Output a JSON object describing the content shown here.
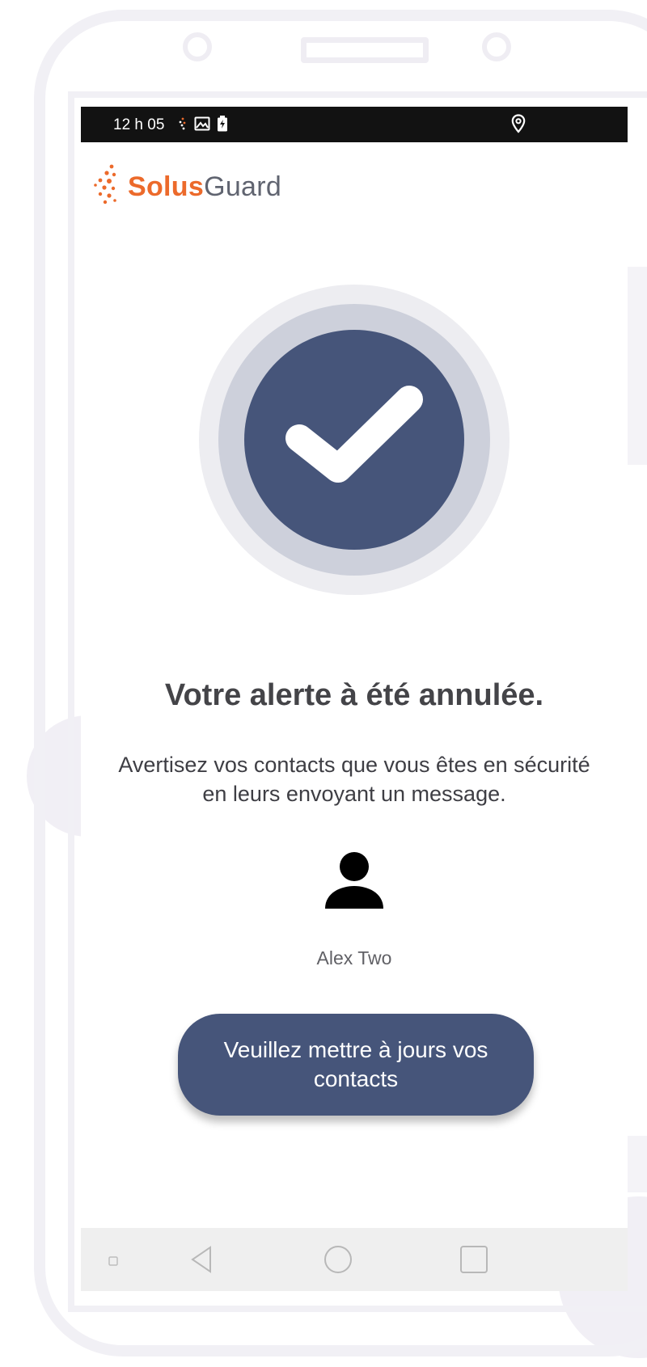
{
  "status_bar": {
    "time": "12 h 05"
  },
  "app": {
    "logo_primary": "Solus",
    "logo_secondary": "Guard",
    "brand_color": "#ec6a2b",
    "accent_color": "#46557a"
  },
  "confirmation": {
    "icon": "checkmark-icon",
    "title": "Votre alerte à été annulée.",
    "message": "Avertisez vos contacts que vous êtes en sécurité en leurs envoyant un message."
  },
  "contact": {
    "icon": "person-icon",
    "name": "Alex Two"
  },
  "actions": {
    "update_contacts_label": "Veuillez mettre à jours vos contacts"
  },
  "navigation": {
    "icons": [
      "back-icon",
      "home-icon",
      "recents-icon"
    ]
  }
}
